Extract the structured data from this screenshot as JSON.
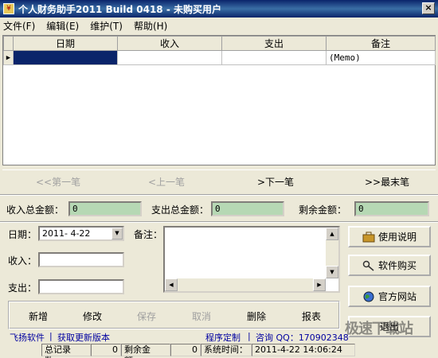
{
  "window": {
    "title": "个人财务助手2011 Build 0418 - 未购买用户",
    "close_glyph": "×"
  },
  "menu": [
    "文件(F)",
    "编辑(E)",
    "维护(T)",
    "帮助(H)"
  ],
  "grid": {
    "columns": [
      "日期",
      "收入",
      "支出",
      "备注"
    ],
    "rows": [
      {
        "date": "",
        "income": "",
        "expense": "",
        "memo": "(Memo)"
      }
    ]
  },
  "nav": {
    "first": "<<第一笔",
    "prev": "<上一笔",
    "next": ">下一笔",
    "last": ">>最末笔"
  },
  "totals": {
    "income_label": "收入总金额：",
    "income_value": "0",
    "expense_label": "支出总金额：",
    "expense_value": "0",
    "balance_label": "剩余金额：",
    "balance_value": "0"
  },
  "form": {
    "date_label": "日期：",
    "date_value": "2011- 4-22",
    "memo_label": "备注：",
    "income_label": "收入：",
    "income_value": "",
    "expense_label": "支出：",
    "expense_value": ""
  },
  "side_buttons": {
    "help": "使用说明",
    "buy": "软件购买",
    "site": "官方网站",
    "exit": "退出"
  },
  "actions": {
    "add": "新增",
    "edit": "修改",
    "save": "保存",
    "cancel": "取消",
    "delete": "删除",
    "report": "报表"
  },
  "links": {
    "brand": "飞扬软件",
    "update": "获取更新版本",
    "custom": "程序定制",
    "qq": "咨询 QQ：170902348"
  },
  "status": {
    "records_label": "总记录数：",
    "records_value": "0",
    "balance_label": "剩余金额：",
    "balance_value": "0",
    "time_label": "系统时间：",
    "time_value": "2011-4-22 14:06:24"
  },
  "watermark": "极速下载站"
}
